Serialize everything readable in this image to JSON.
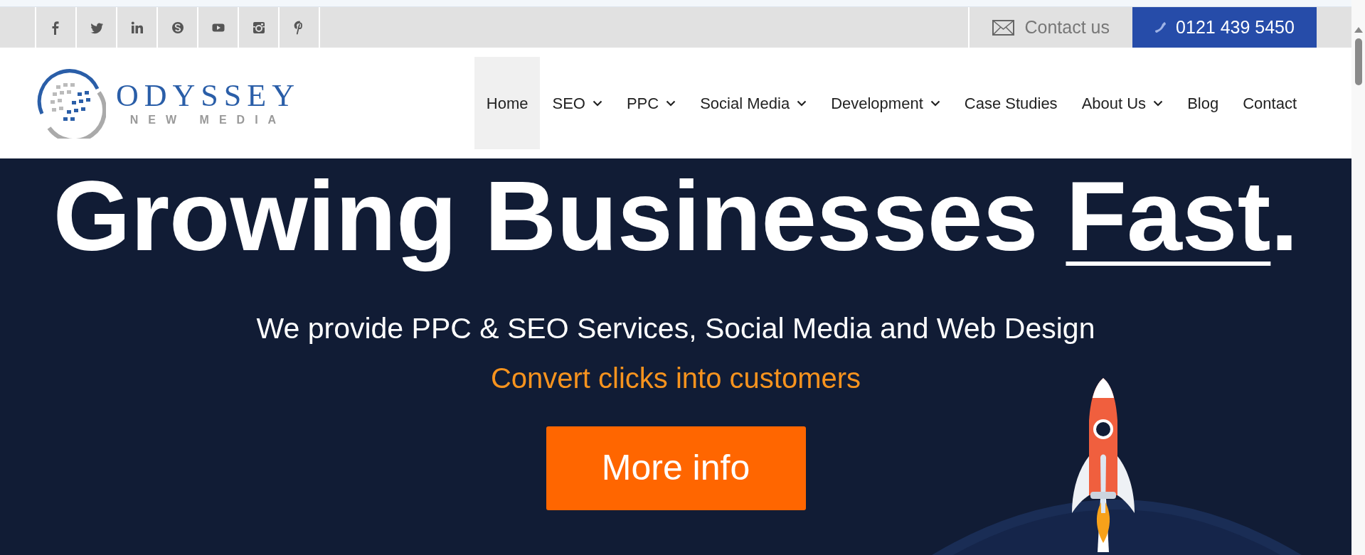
{
  "topbar": {
    "social": [
      {
        "kind": "facebook"
      },
      {
        "kind": "twitter"
      },
      {
        "kind": "linkedin"
      },
      {
        "kind": "skype"
      },
      {
        "kind": "youtube"
      },
      {
        "kind": "instagram"
      },
      {
        "kind": "pinterest"
      }
    ],
    "contact_link": "Contact us",
    "phone": "0121 439 5450"
  },
  "logo": {
    "name": "ODYSSEY",
    "tagline": "NEW MEDIA"
  },
  "nav": [
    {
      "label": "Home",
      "selected": true,
      "dropdown": false
    },
    {
      "label": "SEO",
      "selected": false,
      "dropdown": true
    },
    {
      "label": "PPC",
      "selected": false,
      "dropdown": true
    },
    {
      "label": "Social Media",
      "selected": false,
      "dropdown": true
    },
    {
      "label": "Development",
      "selected": false,
      "dropdown": true
    },
    {
      "label": "Case Studies",
      "selected": false,
      "dropdown": false
    },
    {
      "label": "About Us",
      "selected": false,
      "dropdown": true
    },
    {
      "label": "Blog",
      "selected": false,
      "dropdown": false
    },
    {
      "label": "Contact",
      "selected": false,
      "dropdown": false
    }
  ],
  "hero": {
    "heading": [
      {
        "text": "Growing Businesses ",
        "underline": false
      },
      {
        "text": "Fast",
        "underline": true
      },
      {
        "text": ".",
        "underline": false
      }
    ],
    "subtitle": "We provide PPC & SEO Services, Social Media and Web Design",
    "tagline": "Convert clicks into customers",
    "button": "More info"
  }
}
